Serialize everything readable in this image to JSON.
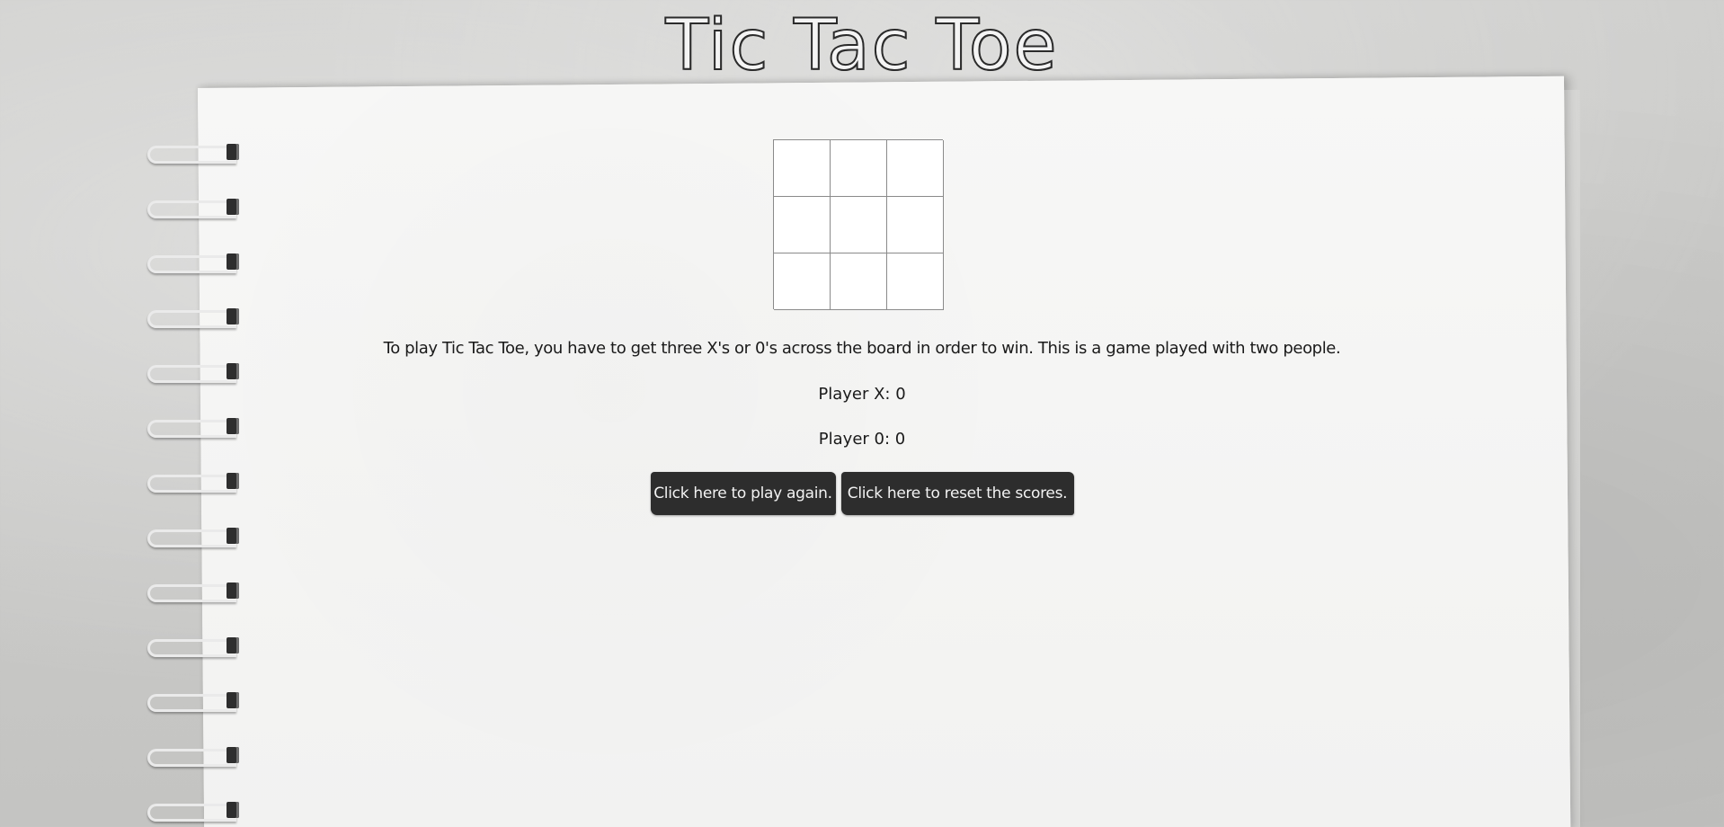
{
  "header": {
    "title": "Tic Tac Toe"
  },
  "board": {
    "cells": [
      "",
      "",
      "",
      "",
      "",
      "",
      "",
      "",
      ""
    ]
  },
  "instructions": "To play Tic Tac Toe, you have to get three X's or 0's across the board in order to win. This is a game played with two people.",
  "scores": {
    "player_x": "Player X: 0",
    "player_o": "Player 0: 0"
  },
  "buttons": {
    "play_again": "Click here to play again.",
    "reset_scores": "Click here to reset the scores."
  },
  "colors": {
    "button_bg": "#2d2d2d",
    "button_text": "#f2f2f2",
    "paper": "#f6f6f5",
    "background": "#c9c9c7"
  }
}
